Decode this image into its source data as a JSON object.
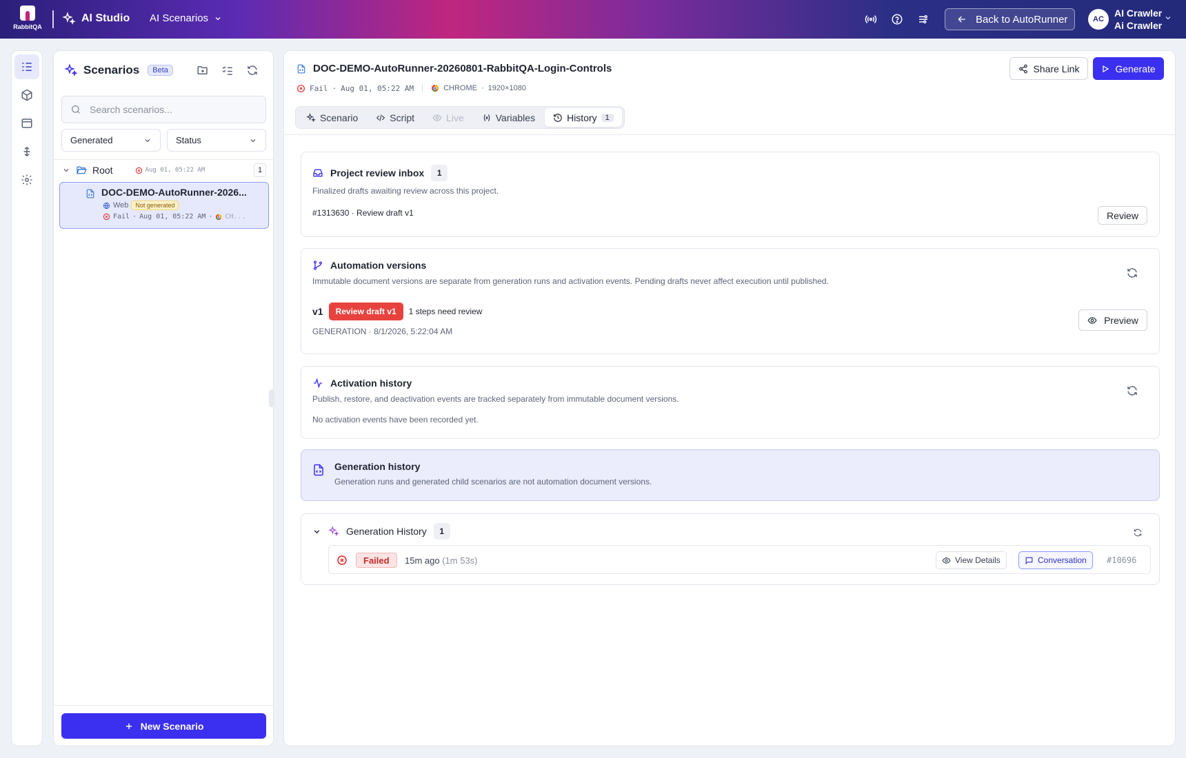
{
  "topbar": {
    "logo_text": "RabbitQA",
    "studio_label": "AI Studio",
    "nav_dropdown": "AI Scenarios",
    "back_label": "Back to AutoRunner",
    "avatar_initials": "AC",
    "user_name": "AI Crawler",
    "user_role": "Ai Crawler"
  },
  "panel": {
    "title": "Scenarios",
    "beta": "Beta",
    "search_placeholder": "Search scenarios...",
    "filter_type": "Generated",
    "filter_status": "Status",
    "root_label": "Root",
    "root_date": "Aug 01, 05:22 AM",
    "root_count": "1",
    "scenario": {
      "name": "DOC-DEMO-AutoRunner-2026...",
      "platform": "Web",
      "gen_status": "Not generated",
      "status": "Fail",
      "date": "Aug 01, 05:22 AM",
      "browser": "CH..."
    },
    "new_button": "New Scenario"
  },
  "main": {
    "doc_title": "DOC-DEMO-AutoRunner-20260801-RabbitQA-Login-Controls",
    "status": "Fail",
    "date": "Aug 01, 05:22 AM",
    "browser": "CHROME",
    "resolution": "1920×1080",
    "share_label": "Share Link",
    "generate_label": "Generate",
    "tabs": [
      {
        "label": "Scenario"
      },
      {
        "label": "Script"
      },
      {
        "label": "Live"
      },
      {
        "label": "Variables"
      },
      {
        "label": "History",
        "count": "1"
      }
    ]
  },
  "inbox": {
    "title": "Project review inbox",
    "count": "1",
    "desc": "Finalized drafts awaiting review across this project.",
    "item": "#1313630 · Review draft v1",
    "review_button": "Review"
  },
  "versions": {
    "title": "Automation versions",
    "desc": "Immutable document versions are separate from generation runs and activation events. Pending drafts never affect execution until published.",
    "version": "v1",
    "draft_badge": "Review draft v1",
    "steps_note": "1 steps need review",
    "meta": "GENERATION · 8/1/2026, 5:22:04 AM",
    "preview_button": "Preview"
  },
  "activation": {
    "title": "Activation history",
    "desc": "Publish, restore, and deactivation events are tracked separately from immutable document versions.",
    "empty": "No activation events have been recorded yet."
  },
  "gen_info": {
    "title": "Generation history",
    "desc": "Generation runs and generated child scenarios are not automation document versions."
  },
  "gen_history": {
    "title": "Generation History",
    "count": "1",
    "run": {
      "status": "Failed",
      "ago": "15m ago",
      "duration": "(1m 53s)",
      "details_label": "View Details",
      "conversation_label": "Conversation",
      "run_id": "#10696"
    }
  },
  "colors": {
    "accent": "#3b2ff0",
    "fail": "#e23c3c",
    "draft_badge": "#e8423f"
  }
}
